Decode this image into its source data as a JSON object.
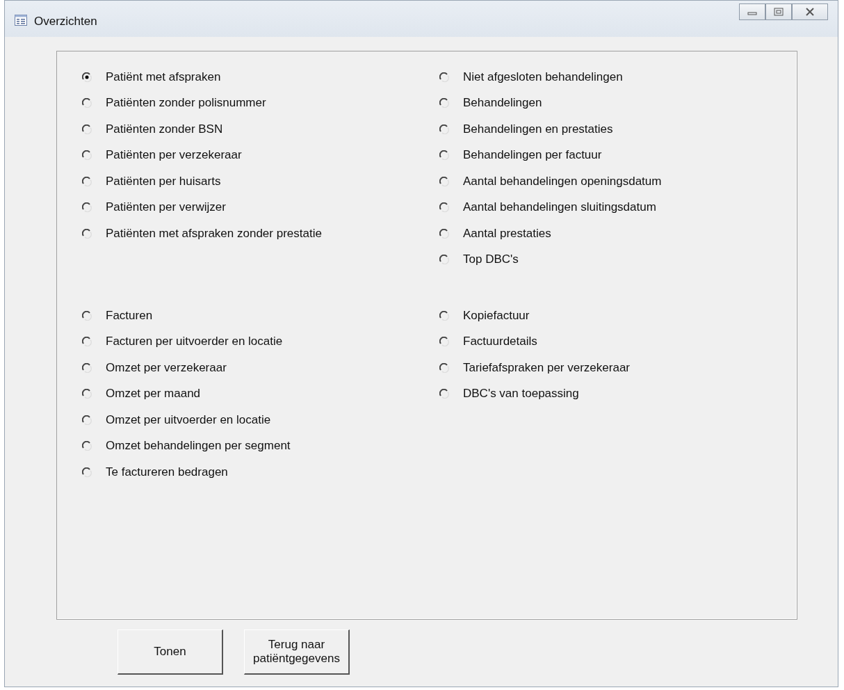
{
  "window": {
    "title": "Overzichten"
  },
  "sections": [
    {
      "left": [
        {
          "label": "Patiënt met afspraken",
          "selected": true
        },
        {
          "label": "Patiënten zonder polisnummer",
          "selected": false
        },
        {
          "label": "Patiënten zonder BSN",
          "selected": false
        },
        {
          "label": "Patiënten per verzekeraar",
          "selected": false
        },
        {
          "label": "Patiënten per huisarts",
          "selected": false
        },
        {
          "label": "Patiënten per verwijzer",
          "selected": false
        },
        {
          "label": "Patiënten met afspraken zonder prestatie",
          "selected": false
        }
      ],
      "right": [
        {
          "label": "Niet afgesloten behandelingen",
          "selected": false
        },
        {
          "label": "Behandelingen",
          "selected": false
        },
        {
          "label": "Behandelingen en prestaties",
          "selected": false
        },
        {
          "label": "Behandelingen per factuur",
          "selected": false
        },
        {
          "label": "Aantal behandelingen openingsdatum",
          "selected": false
        },
        {
          "label": "Aantal behandelingen sluitingsdatum",
          "selected": false
        },
        {
          "label": "Aantal prestaties",
          "selected": false
        },
        {
          "label": "Top DBC's",
          "selected": false
        }
      ]
    },
    {
      "left": [
        {
          "label": "Facturen",
          "selected": false
        },
        {
          "label": "Facturen per uitvoerder en locatie",
          "selected": false
        },
        {
          "label": "Omzet per verzekeraar",
          "selected": false
        },
        {
          "label": "Omzet per maand",
          "selected": false
        },
        {
          "label": "Omzet per uitvoerder en locatie",
          "selected": false
        },
        {
          "label": "Omzet behandelingen per segment",
          "selected": false
        },
        {
          "label": "Te factureren bedragen",
          "selected": false
        }
      ],
      "right": [
        {
          "label": "Kopiefactuur",
          "selected": false
        },
        {
          "label": "Factuurdetails",
          "selected": false
        },
        {
          "label": "Tariefafspraken per verzekeraar",
          "selected": false
        },
        {
          "label": "DBC's van toepassing",
          "selected": false
        }
      ]
    }
  ],
  "buttons": [
    {
      "label": "Tonen"
    },
    {
      "label": "Terug naar patiëntgegevens"
    }
  ]
}
